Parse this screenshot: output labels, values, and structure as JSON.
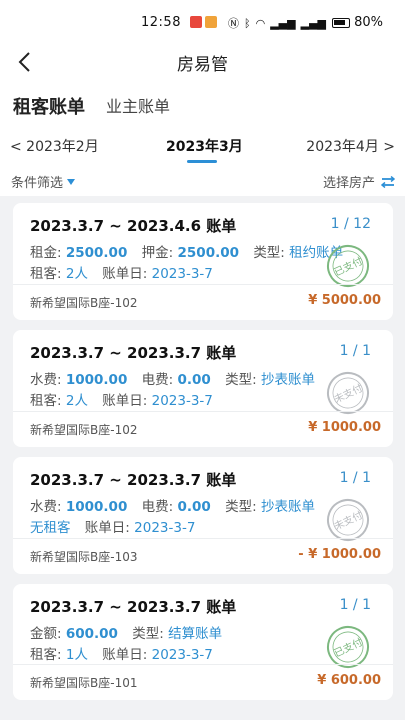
{
  "status_bar": {
    "time": "12:58",
    "battery": "80%"
  },
  "nav": {
    "title": "房易管"
  },
  "tabs": [
    {
      "label": "租客账单"
    },
    {
      "label": "业主账单"
    }
  ],
  "months": {
    "prev": "< 2023年2月",
    "current": "2023年3月",
    "next": "2023年4月 >"
  },
  "filter": {
    "left": "条件筛选",
    "right": "选择房产"
  },
  "cards": [
    {
      "title": "2023.3.7 ~ 2023.4.6 账单",
      "page": "1 / 12",
      "line1": [
        {
          "k": "租金:",
          "v": "2500.00"
        },
        {
          "k": "押金:",
          "v": "2500.00"
        },
        {
          "k": "类型:",
          "v": "租约账单"
        }
      ],
      "line2": [
        {
          "k": "租客:",
          "v": "2人"
        },
        {
          "k": "账单日:",
          "v": "2023-3-7"
        }
      ],
      "address": "新希望国际B座-102",
      "amount": "¥ 5000.00",
      "stamp": {
        "text": "已支付",
        "color": "#7cb87f"
      }
    },
    {
      "title": "2023.3.7 ~ 2023.3.7 账单",
      "page": "1 / 1",
      "line1": [
        {
          "k": "水费:",
          "v": "1000.00"
        },
        {
          "k": "电费:",
          "v": "0.00"
        },
        {
          "k": "类型:",
          "v": "抄表账单"
        }
      ],
      "line2": [
        {
          "k": "租客:",
          "v": "2人"
        },
        {
          "k": "账单日:",
          "v": "2023-3-7"
        }
      ],
      "address": "新希望国际B座-102",
      "amount": "¥ 1000.00",
      "stamp": {
        "text": "未支付",
        "color": "#b9bcc0"
      }
    },
    {
      "title": "2023.3.7 ~ 2023.3.7 账单",
      "page": "1 / 1",
      "line1": [
        {
          "k": "水费:",
          "v": "1000.00"
        },
        {
          "k": "电费:",
          "v": "0.00"
        },
        {
          "k": "类型:",
          "v": "抄表账单"
        }
      ],
      "line2": [
        {
          "k": "",
          "v": "无租客"
        },
        {
          "k": "账单日:",
          "v": "2023-3-7"
        }
      ],
      "address": "新希望国际B座-103",
      "amount": "- ¥ 1000.00",
      "stamp": {
        "text": "未支付",
        "color": "#b9bcc0"
      }
    },
    {
      "title": "2023.3.7 ~ 2023.3.7 账单",
      "page": "1 / 1",
      "line1": [
        {
          "k": "金额:",
          "v": "600.00"
        },
        {
          "k": "类型:",
          "v": "结算账单"
        }
      ],
      "line2": [
        {
          "k": "租客:",
          "v": "1人"
        },
        {
          "k": "账单日:",
          "v": "2023-3-7"
        }
      ],
      "address": "新希望国际B座-101",
      "amount": "¥ 600.00",
      "stamp": {
        "text": "已支付",
        "color": "#7cb87f"
      }
    }
  ]
}
